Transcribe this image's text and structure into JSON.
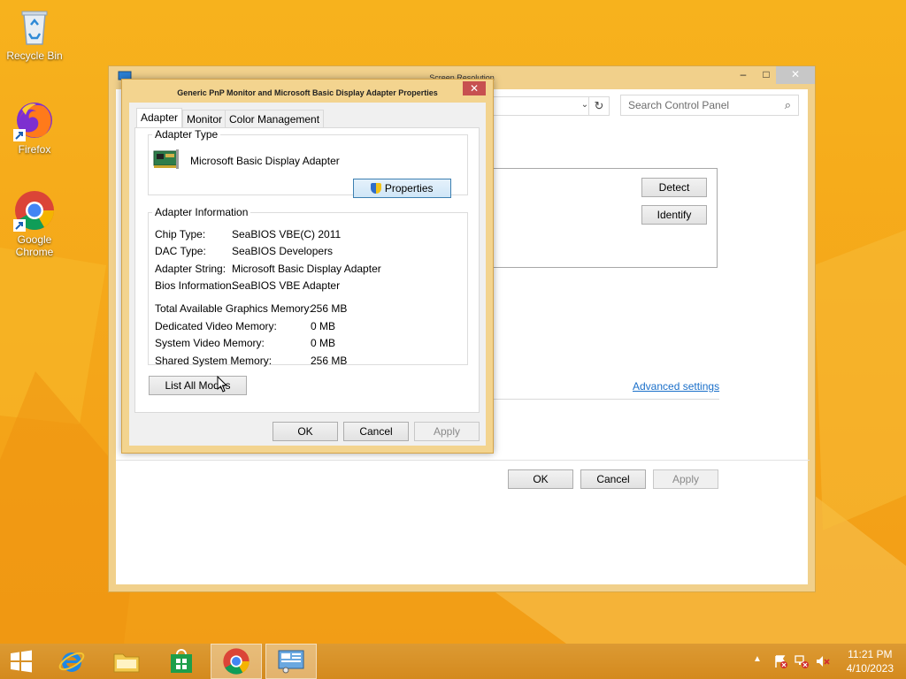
{
  "desktop": {
    "icons": [
      {
        "label": "Recycle Bin"
      },
      {
        "label": "Firefox"
      },
      {
        "label": "Google Chrome"
      }
    ]
  },
  "screen_resolution_window": {
    "title": "Screen Resolution",
    "search_placeholder": "Search Control Panel",
    "detect_label": "Detect",
    "identify_label": "Identify",
    "advanced_settings_label": "Advanced settings",
    "ok_label": "OK",
    "cancel_label": "Cancel",
    "apply_label": "Apply"
  },
  "properties_dialog": {
    "title": "Generic PnP Monitor and Microsoft Basic Display Adapter Properties",
    "tabs": [
      "Adapter",
      "Monitor",
      "Color Management"
    ],
    "adapter_type_group": "Adapter Type",
    "adapter_name": "Microsoft Basic Display Adapter",
    "properties_label": "Properties",
    "adapter_info_group": "Adapter Information",
    "info": [
      {
        "label": "Chip Type:",
        "value": "SeaBIOS VBE(C) 2011"
      },
      {
        "label": "DAC Type:",
        "value": "SeaBIOS Developers"
      },
      {
        "label": "Adapter String:",
        "value": "Microsoft Basic Display Adapter"
      },
      {
        "label": "Bios Information:",
        "value": "SeaBIOS VBE Adapter"
      }
    ],
    "memory": [
      {
        "label": "Total Available Graphics Memory:",
        "value": "256 MB"
      },
      {
        "label": "Dedicated Video Memory:",
        "value": "0 MB"
      },
      {
        "label": "System Video Memory:",
        "value": "0 MB"
      },
      {
        "label": "Shared System Memory:",
        "value": "256 MB"
      }
    ],
    "list_all_modes_label": "List All Modes",
    "ok_label": "OK",
    "cancel_label": "Cancel",
    "apply_label": "Apply"
  },
  "taskbar": {
    "time": "11:21 PM",
    "date": "4/10/2023"
  }
}
